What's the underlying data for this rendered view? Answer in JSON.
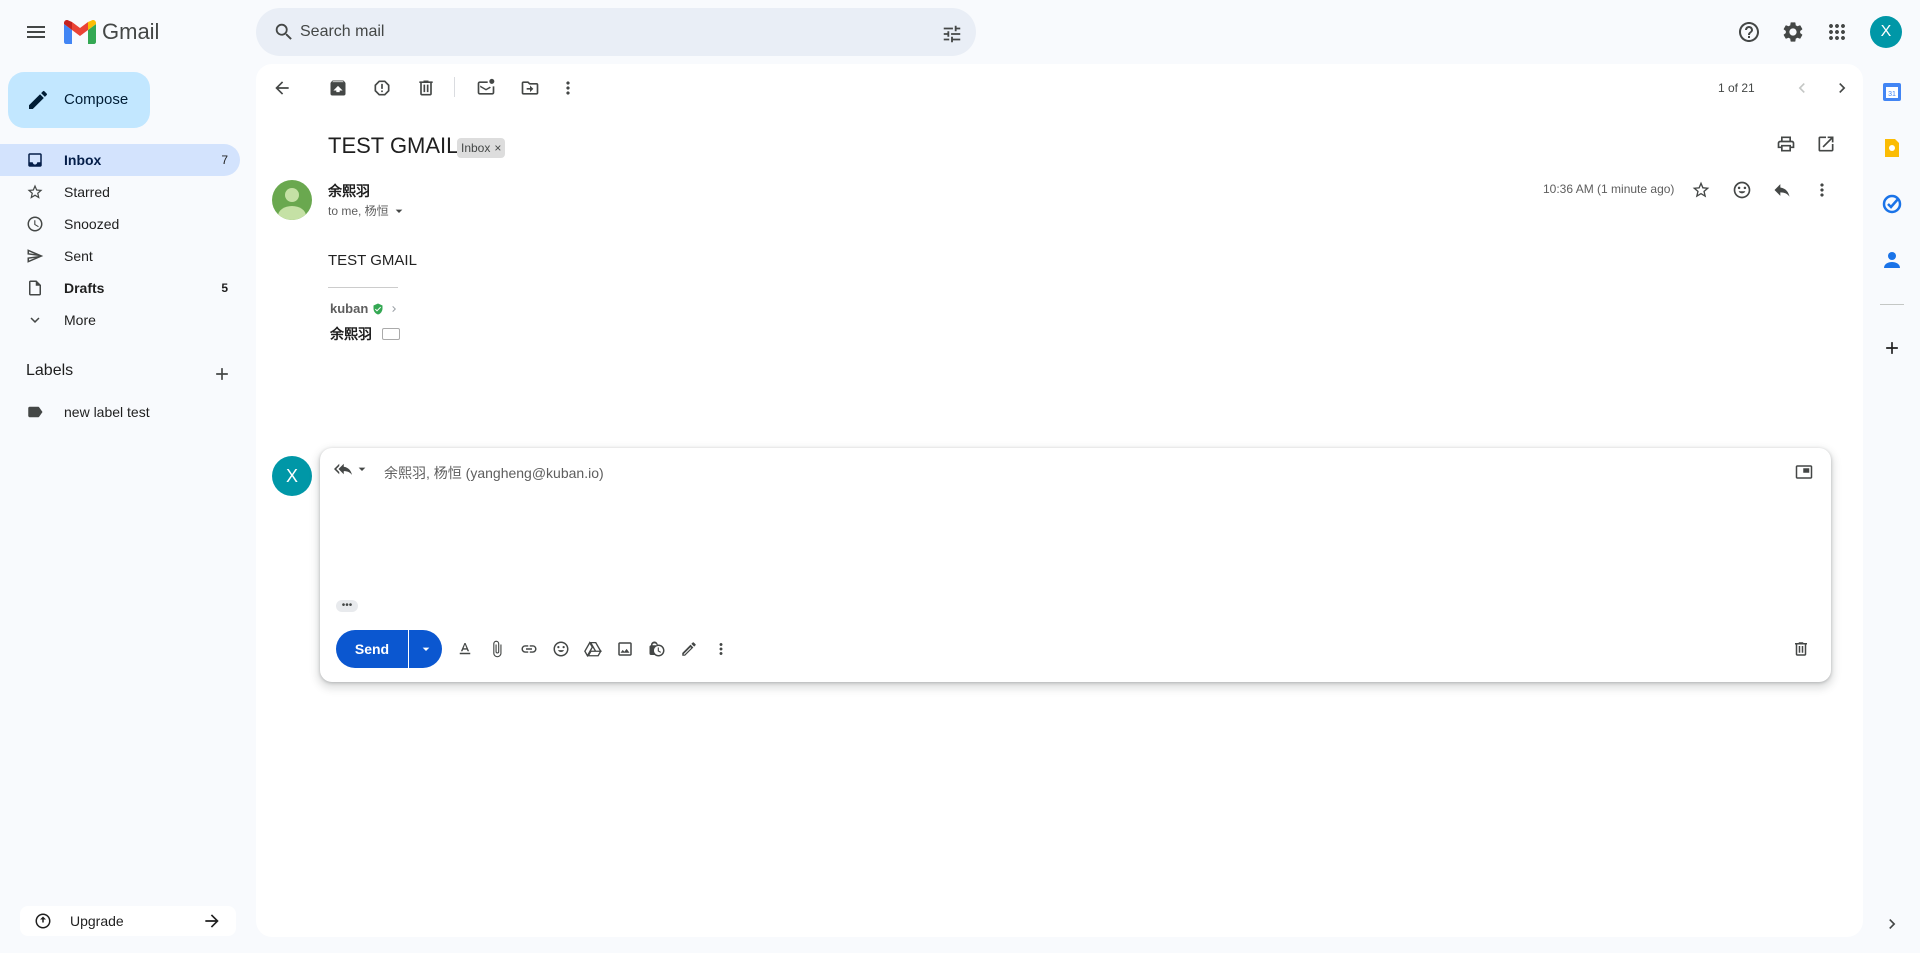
{
  "app": {
    "name": "Gmail"
  },
  "search": {
    "placeholder": "Search mail"
  },
  "header": {
    "account_initial": "X"
  },
  "sidebar": {
    "compose_label": "Compose",
    "items": [
      {
        "label": "Inbox",
        "count": "7",
        "icon": "inbox-icon",
        "active": true
      },
      {
        "label": "Starred",
        "count": "",
        "icon": "star-icon"
      },
      {
        "label": "Snoozed",
        "count": "",
        "icon": "clock-icon"
      },
      {
        "label": "Sent",
        "count": "",
        "icon": "send-icon"
      },
      {
        "label": "Drafts",
        "count": "5",
        "icon": "draft-icon",
        "bold": true
      },
      {
        "label": "More",
        "count": "",
        "icon": "chevron-down-icon"
      }
    ],
    "labels_title": "Labels",
    "labels": [
      {
        "label": "new label test",
        "icon": "label-icon"
      }
    ],
    "upgrade_label": "Upgrade"
  },
  "toolbar": {
    "pager": "1 of 21"
  },
  "message": {
    "subject": "TEST GMAIL",
    "chip_label": "Inbox",
    "sender": "余熙羽",
    "recipients": "to me, 杨恒",
    "timestamp": "10:36 AM (1 minute ago)",
    "body": "TEST GMAIL",
    "signature_brand": "kuban",
    "signature_name": "余熙羽"
  },
  "reply": {
    "avatar_initial": "X",
    "to": "余熙羽, 杨恒 (yangheng@kuban.io)",
    "send_label": "Send",
    "trimmed_label": "•••"
  },
  "colors": {
    "accent": "#0b57d0",
    "compose_bg": "#c2e7ff",
    "active_nav": "#d3e3fd",
    "avatar": "#0097a7",
    "sender_avatar": "#6aa84f"
  }
}
